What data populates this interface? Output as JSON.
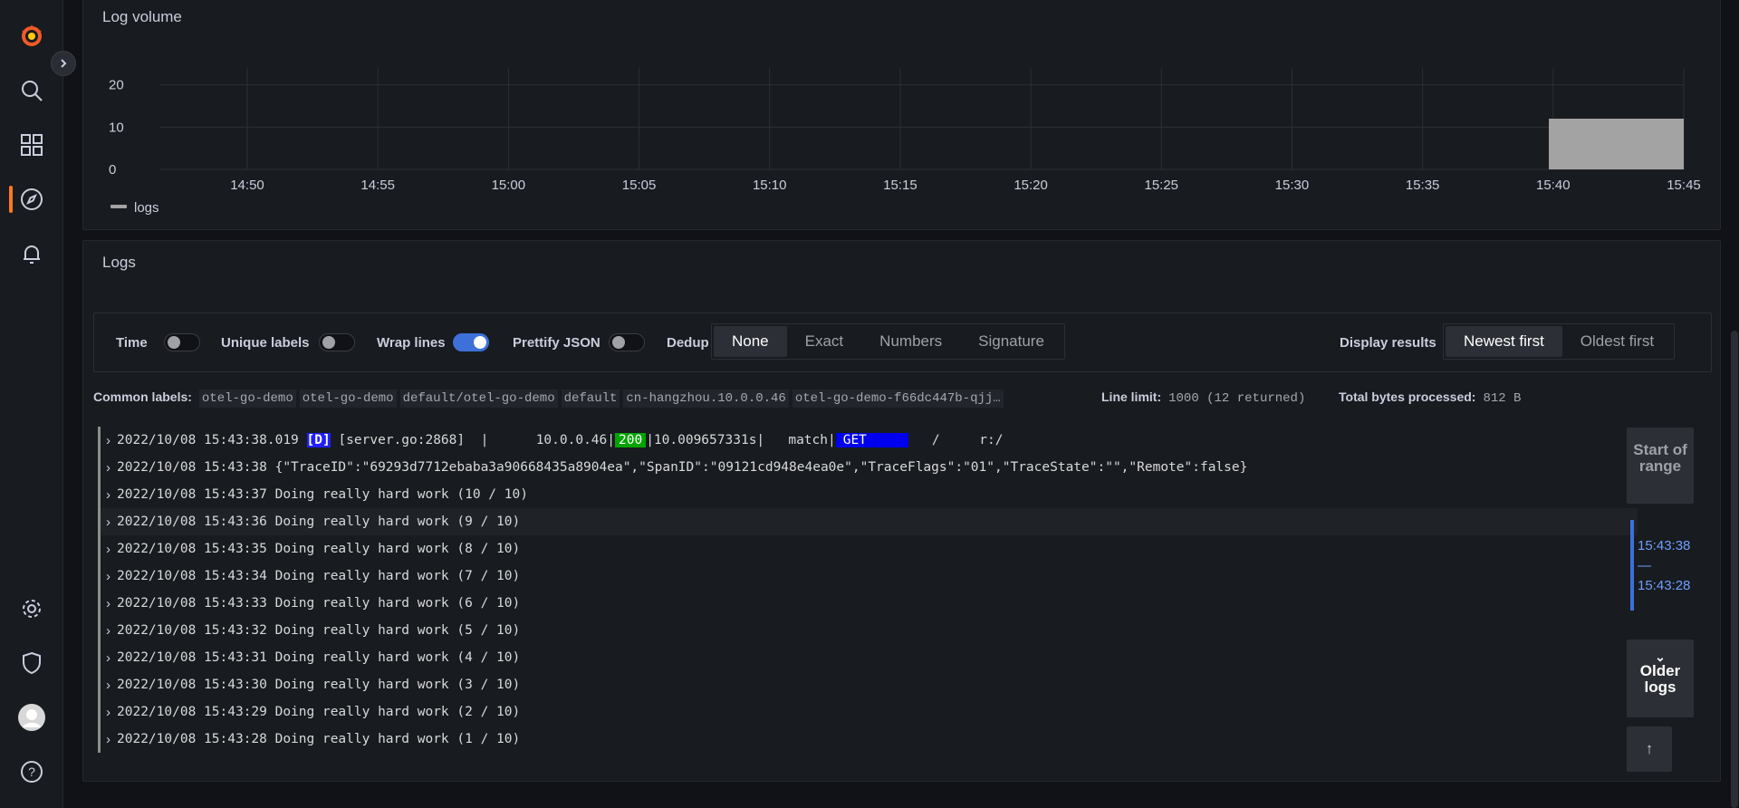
{
  "sidebar": {
    "icons": [
      "grafana-logo",
      "search-icon",
      "dashboards-icon",
      "explore-icon",
      "alerting-icon",
      "settings-icon",
      "shield-icon",
      "avatar",
      "help-icon"
    ]
  },
  "log_volume": {
    "title": "Log volume",
    "legend": "logs"
  },
  "chart_data": {
    "type": "bar",
    "title": "Log volume",
    "x_ticks": [
      "14:50",
      "14:55",
      "15:00",
      "15:05",
      "15:10",
      "15:15",
      "15:20",
      "15:25",
      "15:30",
      "15:35",
      "15:40",
      "15:45"
    ],
    "y_ticks": [
      "0",
      "10",
      "20"
    ],
    "ylim": [
      0,
      24
    ],
    "series": [
      {
        "name": "logs",
        "color": "#a3a3a3",
        "bars": [
          {
            "start": "15:39:50",
            "end": "15:45:00",
            "value": 12
          }
        ]
      }
    ],
    "grid": true,
    "legend": "bottom-left"
  },
  "logs_panel": {
    "title": "Logs",
    "options": {
      "time": "Time",
      "unique_labels": "Unique labels",
      "wrap_lines": "Wrap lines",
      "prettify_json": "Prettify JSON",
      "dedup": "Dedup",
      "dedup_options": [
        "None",
        "Exact",
        "Numbers",
        "Signature"
      ],
      "display_results": "Display results",
      "order_options": [
        "Newest first",
        "Oldest first"
      ]
    },
    "common_labels_label": "Common labels:",
    "common_labels": [
      "otel-go-demo",
      "otel-go-demo",
      "default/otel-go-demo",
      "default",
      "cn-hangzhou.10.0.0.46",
      "otel-go-demo-f66dc447b-qjj…"
    ],
    "line_limit_label": "Line limit:",
    "line_limit_value": "1000 (12 returned)",
    "bytes_label": "Total bytes processed:",
    "bytes_value": "812 B",
    "first_row": {
      "prefix": "2022/10/08 15:43:38.019 ",
      "level": "[D]",
      "mid": " [server.go:2868]  |      10.0.0.46|",
      "status": "200",
      "mid2": "|10.009657331s|   match|",
      "method": "GET",
      "suffix": "   /     r:/"
    },
    "rows": [
      "2022/10/08 15:43:38 {\"TraceID\":\"69293d7712ebaba3a90668435a8904ea\",\"SpanID\":\"09121cd948e4ea0e\",\"TraceFlags\":\"01\",\"TraceState\":\"\",\"Remote\":false}",
      "2022/10/08 15:43:37 Doing really hard work (10 / 10)",
      "2022/10/08 15:43:36 Doing really hard work (9 / 10)",
      "2022/10/08 15:43:35 Doing really hard work (8 / 10)",
      "2022/10/08 15:43:34 Doing really hard work (7 / 10)",
      "2022/10/08 15:43:33 Doing really hard work (6 / 10)",
      "2022/10/08 15:43:32 Doing really hard work (5 / 10)",
      "2022/10/08 15:43:31 Doing really hard work (4 / 10)",
      "2022/10/08 15:43:30 Doing really hard work (3 / 10)",
      "2022/10/08 15:43:29 Doing really hard work (2 / 10)",
      "2022/10/08 15:43:28 Doing really hard work (1 / 10)"
    ],
    "start_of_range": "Start of range",
    "range_top": "15:43:38",
    "range_dash": "—",
    "range_bottom": "15:43:28",
    "older_logs": "Older logs"
  }
}
